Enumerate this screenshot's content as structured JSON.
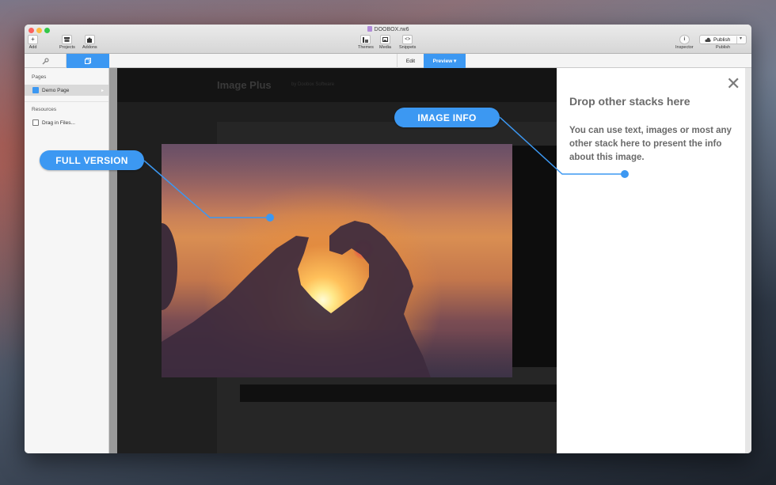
{
  "window": {
    "title": "DOOBOX.rw6"
  },
  "toolbar": {
    "add": "Add",
    "projects": "Projects",
    "addons": "Addons",
    "themes": "Themes",
    "media": "Media",
    "snippets": "Snippets",
    "inspector": "Inspector",
    "publish_button": "Publish",
    "publish_label": "Publish"
  },
  "mode_tabs": {
    "edit": "Edit",
    "preview": "Preview ▾"
  },
  "sidebar": {
    "pages_header": "Pages",
    "page_item": "Demo Page",
    "resources_header": "Resources",
    "resource_item": "Drag in Files..."
  },
  "preview_page": {
    "title": "Image Plus",
    "subtitle": "by Doobox Software"
  },
  "inspector_panel": {
    "title": "Drop other stacks here",
    "body": "You can use text, images or most any other stack here to present the info about this image."
  },
  "callouts": {
    "full_version": "FULL VERSION",
    "image_info": "IMAGE INFO"
  },
  "colors": {
    "accent": "#3c98f2",
    "preview_bg": "#1f1f1f",
    "inspector_text": "#6a6a6a"
  },
  "icons": {
    "add": "plus-icon",
    "projects": "projects-icon",
    "addons": "addons-icon",
    "themes": "themes-icon",
    "media": "media-icon",
    "snippets": "snippets-icon",
    "inspector": "info-icon",
    "close": "close-icon"
  }
}
